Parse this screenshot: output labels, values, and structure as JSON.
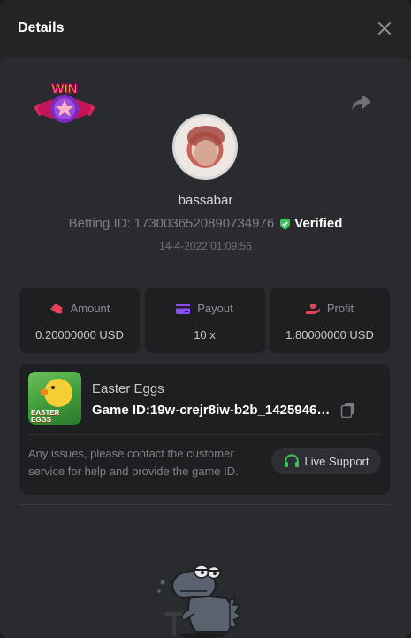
{
  "header": {
    "title": "Details",
    "close_icon": "close-icon"
  },
  "badge": {
    "text": "WIN"
  },
  "player": {
    "username": "bassabar",
    "betting_id_label": "Betting ID:",
    "betting_id": "1730036520890734976",
    "verified_label": "Verified",
    "datetime": "14-4-2022 01:09:56"
  },
  "stats": [
    {
      "label": "Amount",
      "value": "0.20000000 USD",
      "icon": "amount-icon",
      "color": "#e8415a"
    },
    {
      "label": "Payout",
      "value": "10 x",
      "icon": "payout-card-icon",
      "color": "#8a4dff"
    },
    {
      "label": "Profit",
      "value": "1.80000000 USD",
      "icon": "profit-icon",
      "color": "#e8415a"
    }
  ],
  "game": {
    "name": "Easter Eggs",
    "thumb_text": "EASTER EGGS",
    "id_label": "Game ID:",
    "id_value": "19w-crejr8iw-b2b_14259463...",
    "help_text": "Any issues, please contact the customer service for help and provide the game ID.",
    "support_label": "Live Support"
  },
  "colors": {
    "accent_green": "#3dc45c",
    "background": "#232426",
    "card": "#1e1f21"
  }
}
